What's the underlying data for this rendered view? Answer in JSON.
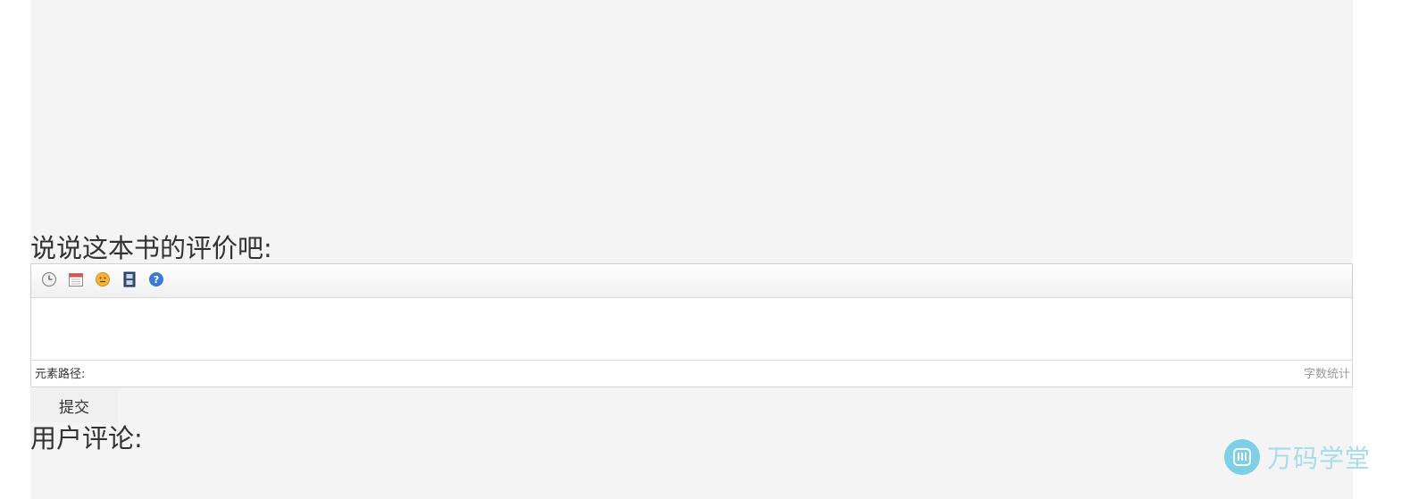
{
  "review": {
    "heading": "说说这本书的评价吧:"
  },
  "editor": {
    "toolbar": [
      {
        "icon": "clock-icon",
        "action": "insert-time"
      },
      {
        "icon": "calendar-icon",
        "action": "insert-date"
      },
      {
        "icon": "emoticon-icon",
        "action": "insert-emotion"
      },
      {
        "icon": "film-icon",
        "action": "insert-video"
      },
      {
        "icon": "help-icon",
        "action": "help"
      }
    ],
    "content": "",
    "element_path_label": "元素路径:",
    "word_count_label": "字数统计"
  },
  "submit": {
    "label": "提交"
  },
  "comments": {
    "heading": "用户评论:"
  },
  "watermark": {
    "text": "万码学堂"
  },
  "colors": {
    "page_background": "#f4f4f4",
    "watermark": "#7dd0e6"
  }
}
